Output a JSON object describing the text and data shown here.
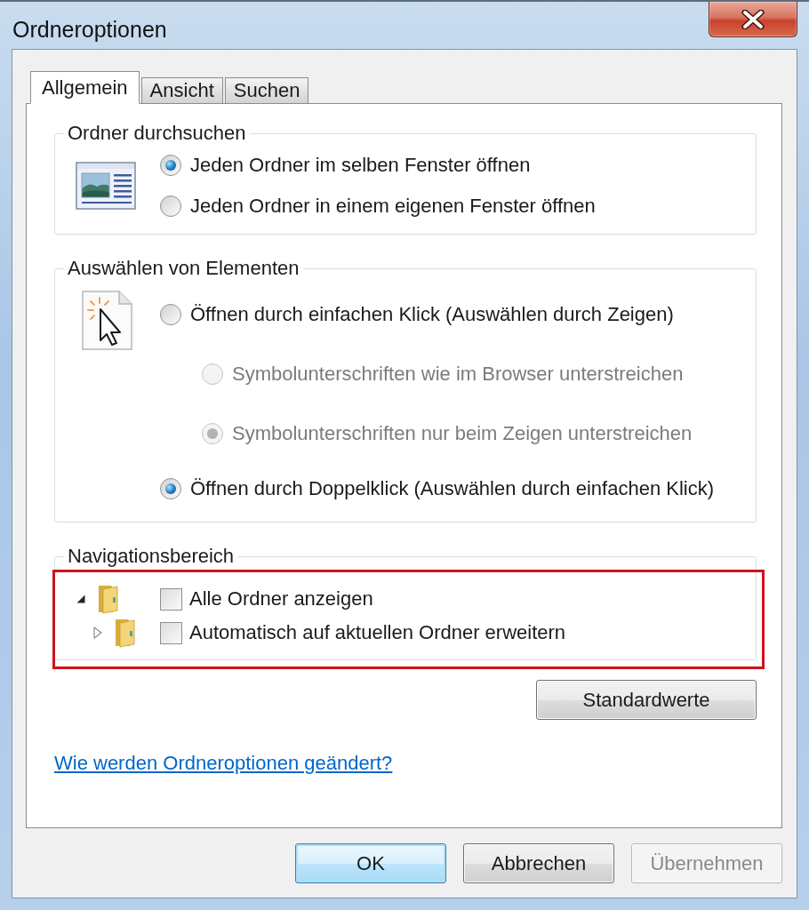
{
  "window": {
    "title": "Ordneroptionen"
  },
  "tabs": [
    {
      "label": "Allgemein",
      "selected": true
    },
    {
      "label": "Ansicht",
      "selected": false
    },
    {
      "label": "Suchen",
      "selected": false
    }
  ],
  "browse_folders": {
    "title": "Ordner durchsuchen",
    "options": [
      {
        "label": "Jeden Ordner im selben Fenster öffnen",
        "selected": true,
        "disabled": false
      },
      {
        "label": "Jeden Ordner in einem eigenen Fenster öffnen",
        "selected": false,
        "disabled": false
      }
    ]
  },
  "select_items": {
    "title": "Auswählen von Elementen",
    "options": [
      {
        "label": "Öffnen durch einfachen Klick (Auswählen durch Zeigen)",
        "selected": false,
        "disabled": false,
        "children": [
          {
            "label": "Symbolunterschriften wie im Browser unterstreichen",
            "selected": false,
            "disabled": true
          },
          {
            "label": "Symbolunterschriften nur beim Zeigen unterstreichen",
            "selected": true,
            "disabled": true
          }
        ]
      },
      {
        "label": "Öffnen durch Doppelklick (Auswählen durch einfachen Klick)",
        "selected": true,
        "disabled": false
      }
    ]
  },
  "navigation_pane": {
    "title": "Navigationsbereich",
    "highlighted": true,
    "options": [
      {
        "kind": "expanded",
        "label": "Alle Ordner anzeigen",
        "checked": false
      },
      {
        "kind": "collapsed",
        "label": "Automatisch auf aktuellen Ordner erweitern",
        "checked": false
      }
    ]
  },
  "defaults_button": {
    "label": "Standardwerte"
  },
  "help_link": "Wie werden Ordneroptionen geändert?",
  "buttons": [
    {
      "label": "OK",
      "default": true,
      "disabled": false
    },
    {
      "label": "Abbrechen",
      "default": false,
      "disabled": false
    },
    {
      "label": "Übernehmen",
      "default": false,
      "disabled": true
    }
  ]
}
